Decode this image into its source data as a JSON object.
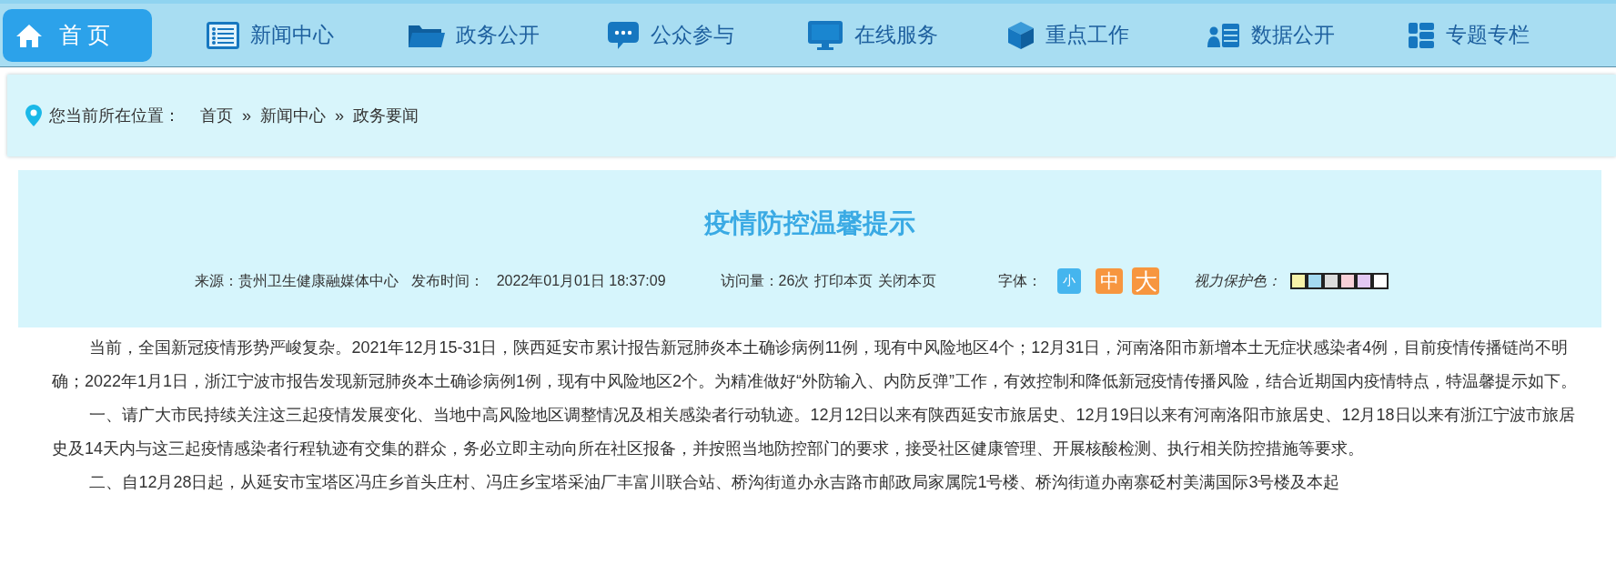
{
  "nav": {
    "items": [
      {
        "label": "首页",
        "selected": true
      },
      {
        "label": "新闻中心",
        "selected": false
      },
      {
        "label": "政务公开",
        "selected": false
      },
      {
        "label": "公众参与",
        "selected": false
      },
      {
        "label": "在线服务",
        "selected": false
      },
      {
        "label": "重点工作",
        "selected": false
      },
      {
        "label": "数据公开",
        "selected": false
      },
      {
        "label": "专题专栏",
        "selected": false
      }
    ]
  },
  "breadcrumb": {
    "prefix": "您当前所在位置：",
    "links": [
      "首页",
      "新闻中心",
      "政务要闻"
    ],
    "separator": "»"
  },
  "article": {
    "title": "疫情防控温馨提示",
    "meta": {
      "source": "来源：贵州卫生健康融媒体中心",
      "published": "发布时间：",
      "time": "2022年01月01日 18:37:09",
      "visits": "访问量：26次",
      "print": "打印本页",
      "close": "关闭本页",
      "font_label": "字体：",
      "font_sizes": [
        {
          "label": "小",
          "kind": "small",
          "selected": true
        },
        {
          "label": "中",
          "kind": "medium",
          "selected": false
        },
        {
          "label": "大",
          "kind": "large",
          "selected": false
        }
      ],
      "eye_label": "视力保护色：",
      "eye_colors": [
        {
          "color": "#f8f2a8"
        },
        {
          "color": "#a4d9f0"
        },
        {
          "color": "#dcdcdc"
        },
        {
          "color": "#f8d0d8"
        },
        {
          "color": "#e3c8f3"
        },
        {
          "color": "#ffffff"
        }
      ]
    },
    "paragraphs": [
      "当前，全国新冠疫情形势严峻复杂。2021年12月15-31日，陕西延安市累计报告新冠肺炎本土确诊病例11例，现有中风险地区4个；12月31日，河南洛阳市新增本土无症状感染者4例，目前疫情传播链尚不明确；2022年1月1日，浙江宁波市报告发现新冠肺炎本土确诊病例1例，现有中风险地区2个。为精准做好“外防输入、内防反弹”工作，有效控制和降低新冠疫情传播风险，结合近期国内疫情特点，特温馨提示如下。",
      "一、请广大市民持续关注这三起疫情发展变化、当地中高风险地区调整情况及相关感染者行动轨迹。12月12日以来有陕西延安市旅居史、12月19日以来有河南洛阳市旅居史、12月18日以来有浙江宁波市旅居史及14天内与这三起疫情感染者行程轨迹有交集的群众，务必立即主动向所在社区报备，并按照当地防控部门的要求，接受社区健康管理、开展核酸检测、执行相关防控措施等要求。",
      "二、自12月28日起，从延安市宝塔区冯庄乡首头庄村、冯庄乡宝塔采油厂丰富川联合站、桥沟街道办永吉路市邮政局家属院1号楼、桥沟街道办南寨砭村美满国际3号楼及本起"
    ]
  }
}
